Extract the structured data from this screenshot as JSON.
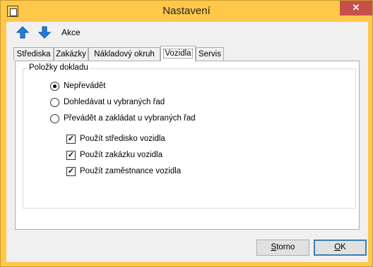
{
  "window": {
    "title": "Nastavení",
    "close_glyph": "✕"
  },
  "toolbar": {
    "up_icon": "arrow-up",
    "down_icon": "arrow-down",
    "action_label": "Akce",
    "arrow_color": "#1e7fe0"
  },
  "tabs": [
    {
      "label": "Střediska",
      "active": false
    },
    {
      "label": "Zakázky",
      "active": false
    },
    {
      "label": "Nákladový okruh",
      "active": false
    },
    {
      "label": "Vozidla",
      "active": true
    },
    {
      "label": "Servis",
      "active": false
    }
  ],
  "group": {
    "label": "Položky dokladu",
    "radios": [
      {
        "label": "Nepřevádět",
        "checked": true
      },
      {
        "label": "Dohledávat u vybraných řad",
        "checked": false
      },
      {
        "label": "Převádět a zakládat u vybraných řad",
        "checked": false
      }
    ],
    "checkboxes": [
      {
        "label": "Použít středisko vozidla",
        "checked": true
      },
      {
        "label": "Použít zakázku vozidla",
        "checked": true
      },
      {
        "label": "Použít zaměstnance vozidla",
        "checked": true
      }
    ]
  },
  "buttons": {
    "cancel": {
      "accel": "S",
      "rest": "torno"
    },
    "ok": {
      "accel": "O",
      "rest": "K"
    }
  },
  "colors": {
    "title_bar": "#ffc84a",
    "close_button": "#c7504b"
  }
}
